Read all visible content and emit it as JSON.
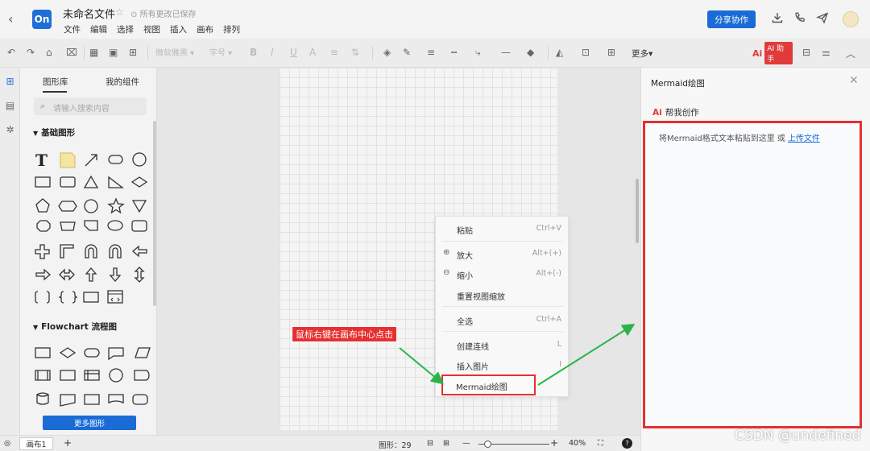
{
  "header": {
    "back_icon": "chevron-left-icon",
    "logo": "On",
    "title": "未命名文件",
    "saved_status": "所有更改已保存",
    "menus": [
      "文件",
      "编辑",
      "选择",
      "视图",
      "插入",
      "画布",
      "排列"
    ],
    "share_label": "分享协作"
  },
  "toolbar": {
    "font_family": "微软雅黑",
    "font_size": "字号",
    "more_label": "更多",
    "ai_label": "AI 助手"
  },
  "library": {
    "tabs": [
      "图形库",
      "我的组件"
    ],
    "search_placeholder": "请输入搜索内容",
    "section_basic": "基础图形",
    "section_flowchart": "Flowchart 流程图",
    "more_shapes": "更多图形"
  },
  "context_menu": {
    "items": [
      {
        "label": "粘贴",
        "shortcut": "Ctrl+V",
        "icon": ""
      },
      {
        "label": "放大",
        "shortcut": "Alt+(+)",
        "icon": "zoom-in-icon"
      },
      {
        "label": "缩小",
        "shortcut": "Alt+(-)",
        "icon": "zoom-out-icon"
      },
      {
        "label": "重置视图缩放",
        "shortcut": "",
        "icon": ""
      },
      {
        "label": "全选",
        "shortcut": "Ctrl+A",
        "icon": ""
      },
      {
        "label": "创建连线",
        "shortcut": "L",
        "icon": ""
      },
      {
        "label": "插入图片",
        "shortcut": "I",
        "icon": ""
      },
      {
        "label": "Mermaid绘图",
        "shortcut": "",
        "icon": ""
      }
    ]
  },
  "annotation": {
    "label": "鼠标右键在画布中心点击",
    "color": "#e53030"
  },
  "panel": {
    "title": "Mermaid绘图",
    "ai_help": "帮我创作",
    "hint": "将Mermaid格式文本粘贴到这里 或",
    "upload_link": "上传文件"
  },
  "status": {
    "page_tab": "画布1",
    "add": "+",
    "shape_count": "图形：29",
    "zoom": "40%"
  },
  "watermark": "CSDN @undefined",
  "colors": {
    "accent": "#1a6bd6",
    "highlight": "#e53030"
  }
}
